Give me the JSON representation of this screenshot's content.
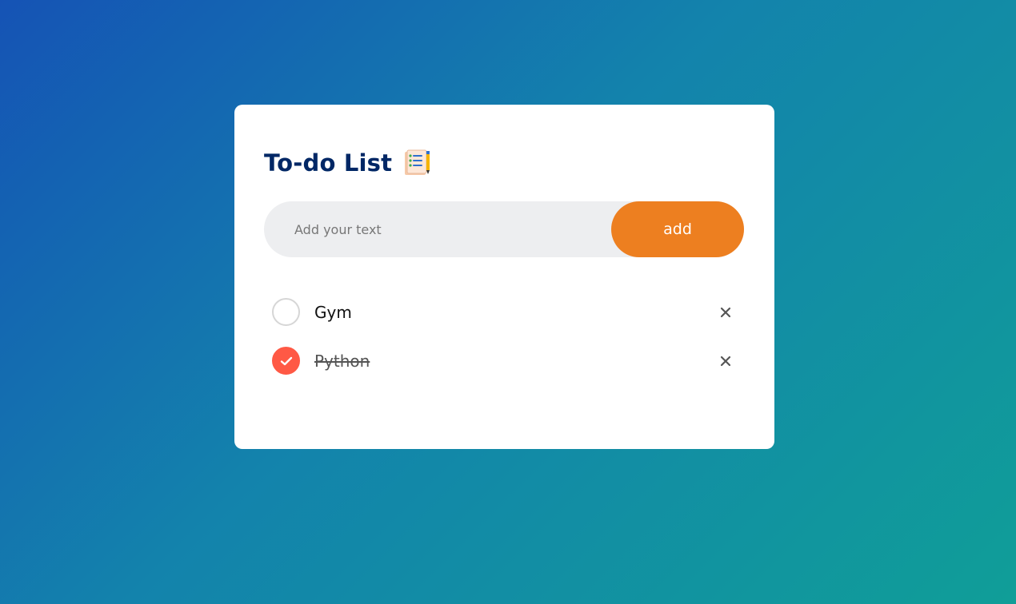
{
  "app": {
    "title": "To-do List",
    "title_icon": "notepad-checklist-icon"
  },
  "input": {
    "placeholder": "Add your text",
    "value": ""
  },
  "add_button": {
    "label": "add"
  },
  "colors": {
    "title": "#002765",
    "accent_orange": "#ed7f20",
    "checked_red": "#ff5945",
    "input_bg": "#edeef0"
  },
  "tasks": [
    {
      "label": "Gym",
      "checked": false,
      "check_icon": "circle-unchecked-icon",
      "delete_icon": "close-icon"
    },
    {
      "label": "Python",
      "checked": true,
      "check_icon": "check-icon",
      "delete_icon": "close-icon"
    }
  ]
}
